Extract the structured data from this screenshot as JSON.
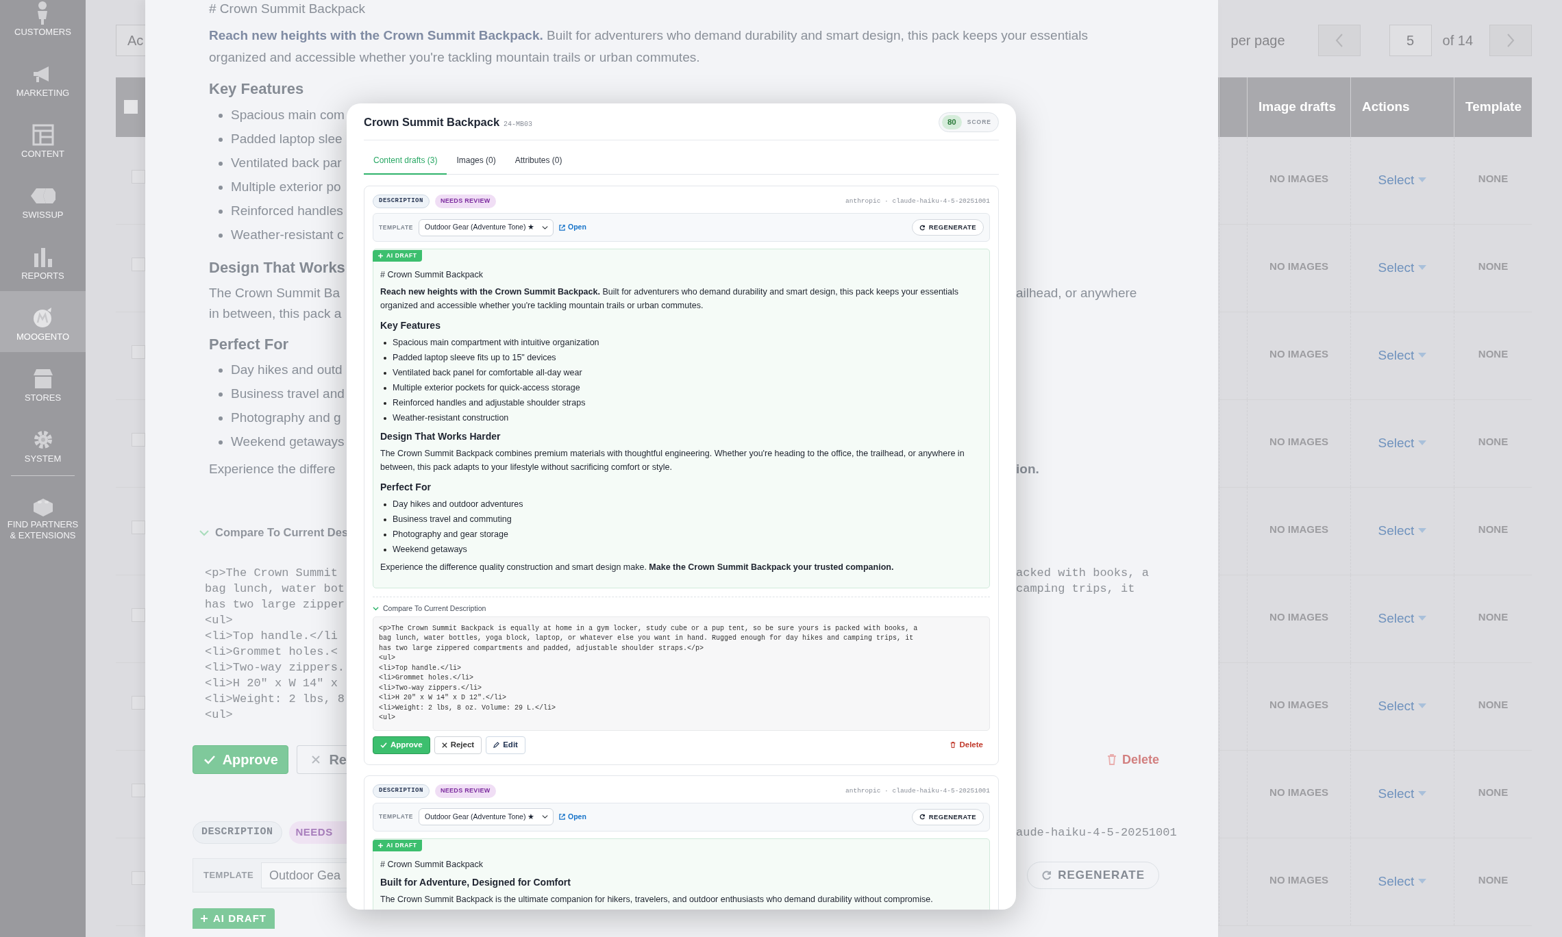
{
  "admin_menu": [
    {
      "label": "CUSTOMERS",
      "selected": false
    },
    {
      "label": "MARKETING",
      "selected": false
    },
    {
      "label": "CONTENT",
      "selected": false
    },
    {
      "label": "SWISSUP",
      "selected": false
    },
    {
      "label": "REPORTS",
      "selected": false
    },
    {
      "label": "MOOGENTO",
      "selected": true
    },
    {
      "label": "STORES",
      "selected": false
    },
    {
      "label": "SYSTEM",
      "selected": false
    },
    {
      "label": "FIND PARTNERS & EXTENSIONS",
      "selected": false
    }
  ],
  "grid": {
    "action_placeholder": "Ac",
    "select_all_checked": false,
    "row_checks": [
      false,
      false,
      false,
      false,
      false,
      false,
      false,
      false,
      false
    ],
    "per_page": "per page",
    "page": "5",
    "page_total": "of 14",
    "columns": [
      "Image drafts",
      "Actions",
      "Template"
    ],
    "rows": [
      {
        "image_drafts": "NO IMAGES",
        "action": "Select",
        "template": "NONE"
      },
      {
        "image_drafts": "NO IMAGES",
        "action": "Select",
        "template": "NONE"
      },
      {
        "image_drafts": "NO IMAGES",
        "action": "Select",
        "template": "NONE"
      },
      {
        "image_drafts": "NO IMAGES",
        "action": "Select",
        "template": "NONE"
      },
      {
        "image_drafts": "NO IMAGES",
        "action": "Select",
        "template": "NONE"
      },
      {
        "image_drafts": "NO IMAGES",
        "action": "Select",
        "template": "NONE"
      },
      {
        "image_drafts": "NO IMAGES",
        "action": "Select",
        "template": "NONE"
      },
      {
        "image_drafts": "NO IMAGES",
        "action": "Select",
        "template": "NONE"
      },
      {
        "image_drafts": "NO IMAGES",
        "action": "Select",
        "template": "NONE"
      }
    ]
  },
  "background_panel": {
    "top_lines": [
      {
        "kind": "text",
        "text": "# Crown Summit Backpack"
      },
      {
        "kind": "text",
        "text": "**Reach new heights with the Crown Summit Backpack.** Built for adventurers who demand durability and smart design, this pack keeps your essentials"
      },
      {
        "kind": "text",
        "text": "organized and accessible whether you're tackling mountain trails or urban commutes."
      },
      {
        "kind": "heading",
        "text": "Key Features"
      }
    ],
    "rows": [
      {
        "kind": "bullet",
        "left": "Spacious main com"
      },
      {
        "kind": "bullet",
        "left": "Padded laptop slee"
      },
      {
        "kind": "bullet",
        "left": "Ventilated back par"
      },
      {
        "kind": "bullet",
        "left": "Multiple exterior po"
      },
      {
        "kind": "bullet",
        "left": "Reinforced handles"
      },
      {
        "kind": "bullet",
        "left": "Weather-resistant c"
      },
      {
        "kind": "heading",
        "left": "Design That Works"
      },
      {
        "kind": "text",
        "left": "The Crown Summit Ba",
        "right": "ailhead, or anywhere"
      },
      {
        "kind": "text",
        "left": "in between, this pack a"
      },
      {
        "kind": "heading",
        "left": "Perfect For"
      },
      {
        "kind": "bullet",
        "left": "Day hikes and outd"
      },
      {
        "kind": "bullet",
        "left": "Business travel and"
      },
      {
        "kind": "bullet",
        "left": "Photography and g"
      },
      {
        "kind": "bullet",
        "left": "Weekend getaways"
      },
      {
        "kind": "text",
        "left": "Experience the differe",
        "right": "**ion.**"
      },
      {
        "kind": "toggle",
        "left": "Compare To Current Des"
      },
      {
        "kind": "code",
        "left": "<p>The Crown Summit",
        "right": "acked with books, a"
      },
      {
        "kind": "code",
        "left": "bag lunch, water bot",
        "right": "camping trips, it"
      },
      {
        "kind": "code",
        "left": "has two large zipper"
      },
      {
        "kind": "code",
        "left": "<ul>"
      },
      {
        "kind": "code",
        "left": "<li>Top handle.</li"
      },
      {
        "kind": "code",
        "left": "<li>Grommet holes.<"
      },
      {
        "kind": "code",
        "left": "<li>Two-way zippers."
      },
      {
        "kind": "code",
        "left": "<li>H 20\" x W 14\" x"
      },
      {
        "kind": "code",
        "left": "<li>Weight: 2 lbs, 8"
      },
      {
        "kind": "code",
        "left": "<ul>"
      },
      {
        "kind": "actions",
        "buttons": [
          "Approve",
          "Re"
        ],
        "right": "Delete"
      },
      {
        "kind": "badges",
        "badges": [
          "DESCRIPTION",
          "NEEDS"
        ],
        "right": "aude-haiku-4-5-20251001"
      },
      {
        "kind": "template",
        "label": "TEMPLATE",
        "field": "Outdoor Gea",
        "right": "REGENERATE"
      },
      {
        "kind": "tag",
        "left": "AI DRAFT"
      }
    ]
  },
  "modal": {
    "title": "Crown Summit Backpack",
    "sku": "24-MB03",
    "score": "80",
    "score_label": "SCORE",
    "tabs": [
      {
        "label": "Content drafts (3)",
        "selected": true
      },
      {
        "label": "Images (0)",
        "selected": false
      },
      {
        "label": "Attributes (0)",
        "selected": false
      }
    ],
    "drafts": [
      {
        "type": "DESCRIPTION",
        "status": "NEEDS REVIEW",
        "meta": "anthropic · claude-haiku-4-5-20251001",
        "template_label": "TEMPLATE",
        "template": "Outdoor Gear (Adventure Tone) ★",
        "open_label": "Open",
        "regenerate_label": "REGENERATE",
        "ai_tag": "AI DRAFT",
        "blocks": [
          {
            "kind": "title",
            "text": "# Crown Summit Backpack"
          },
          {
            "kind": "paragraph",
            "text": "**Reach new heights with the Crown Summit Backpack.** Built for adventurers who demand durability and smart design, this pack keeps your essentials organized and accessible whether you're tackling mountain trails or urban commutes."
          },
          {
            "kind": "heading",
            "text": "Key Features"
          },
          {
            "kind": "list",
            "items": [
              "Spacious main compartment with intuitive organization",
              "Padded laptop sleeve fits up to 15\" devices",
              "Ventilated back panel for comfortable all-day wear",
              "Multiple exterior pockets for quick-access storage",
              "Reinforced handles and adjustable shoulder straps",
              "Weather-resistant construction"
            ]
          },
          {
            "kind": "heading",
            "text": "Design That Works Harder"
          },
          {
            "kind": "paragraph",
            "text": "The Crown Summit Backpack combines premium materials with thoughtful engineering. Whether you're heading to the office, the trailhead, or anywhere in between, this pack adapts to your lifestyle without sacrificing comfort or style."
          },
          {
            "kind": "heading",
            "text": "Perfect For"
          },
          {
            "kind": "list",
            "items": [
              "Day hikes and outdoor adventures",
              "Business travel and commuting",
              "Photography and gear storage",
              "Weekend getaways"
            ]
          },
          {
            "kind": "paragraph",
            "text": "Experience the difference quality construction and smart design make. **Make the Crown Summit Backpack your trusted companion.**"
          }
        ],
        "compare": {
          "label": "Compare To Current Description",
          "expanded": true,
          "lines": [
            "<p>The Crown Summit Backpack is equally at home in a gym locker, study cube or a pup tent, so be sure yours is packed with books, a",
            "bag lunch, water bottles, yoga block, laptop, or whatever else you want in hand. Rugged enough for day hikes and camping trips, it",
            "has two large zippered compartments and padded, adjustable shoulder straps.</p>",
            "<ul>",
            "<li>Top handle.</li>",
            "<li>Grommet holes.</li>",
            "<li>Two-way zippers.</li>",
            "<li>H 20\" x W 14\" x D 12\".</li>",
            "<li>Weight: 2 lbs, 8 oz. Volume: 29 L.</li>",
            "<ul>"
          ]
        },
        "actions": {
          "approve": "Approve",
          "reject": "Reject",
          "edit": "Edit",
          "delete": "Delete"
        }
      },
      {
        "type": "DESCRIPTION",
        "status": "NEEDS REVIEW",
        "meta": "anthropic · claude-haiku-4-5-20251001",
        "template_label": "TEMPLATE",
        "template": "Outdoor Gear (Adventure Tone) ★",
        "open_label": "Open",
        "regenerate_label": "REGENERATE",
        "ai_tag": "AI DRAFT",
        "blocks": [
          {
            "kind": "title",
            "text": "# Crown Summit Backpack"
          },
          {
            "kind": "heading",
            "text": "Built for Adventure, Designed for Comfort"
          },
          {
            "kind": "paragraph",
            "text": "The Crown Summit Backpack is the ultimate companion for hikers, travelers, and outdoor enthusiasts who demand durability without compromise."
          }
        ]
      }
    ]
  }
}
